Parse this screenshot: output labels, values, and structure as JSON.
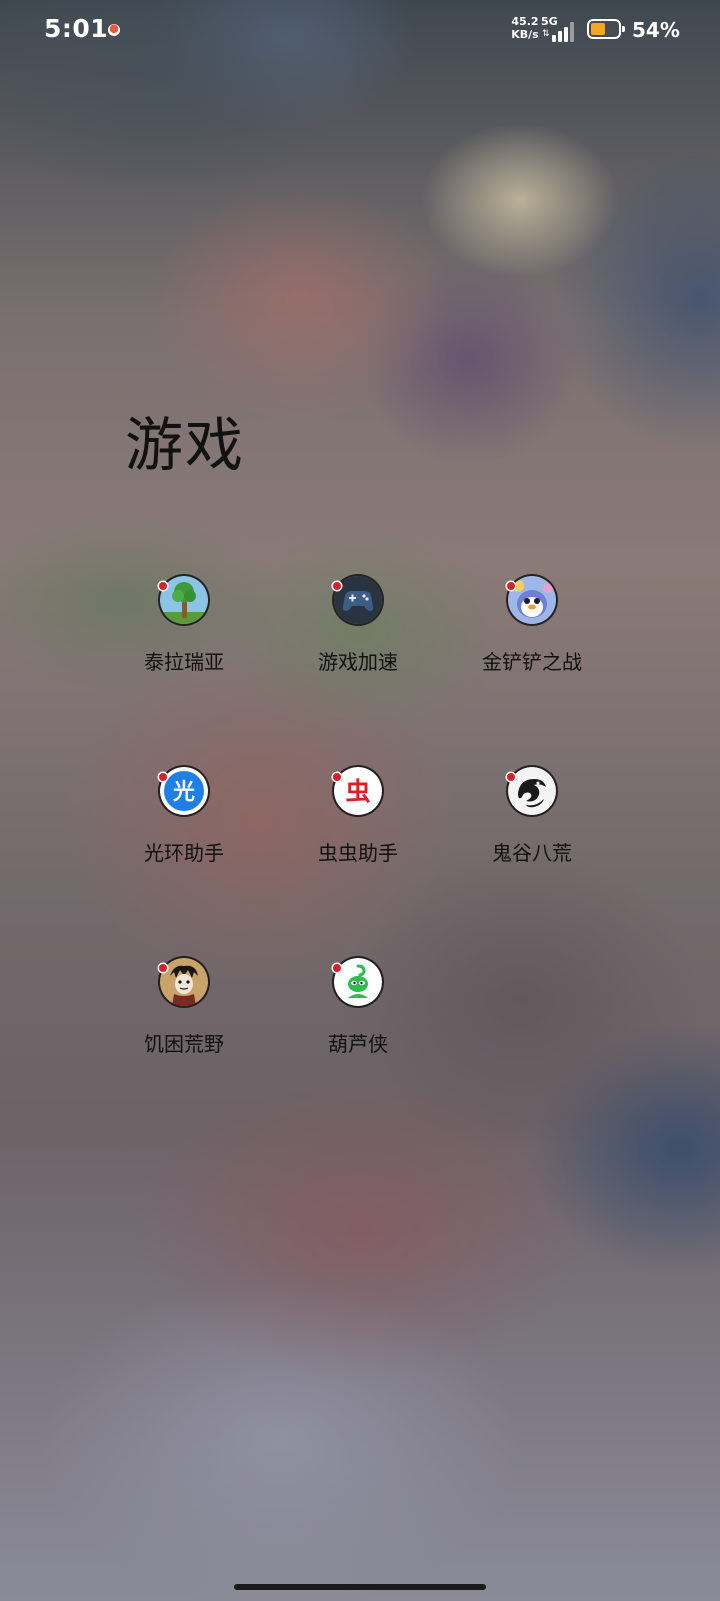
{
  "status_bar": {
    "time": "5:01",
    "net_speed_value": "45.2",
    "net_speed_unit": "KB/s",
    "network_type": "5G",
    "battery_percent": "54%",
    "battery_level": 0.54,
    "battery_color": "#f4a61d",
    "icons": [
      "notification-icon",
      "data-arrows-icon",
      "signal-icon",
      "battery-icon"
    ]
  },
  "folder": {
    "title": "游戏",
    "apps": [
      {
        "label": "泰拉瑞亚",
        "icon": "terraria-tree-icon"
      },
      {
        "label": "游戏加速",
        "icon": "gamepad-icon"
      },
      {
        "label": "金铲铲之战",
        "icon": "penguin-icon"
      },
      {
        "label": "光环助手",
        "icon": "guanghuan-icon",
        "icon_text": "光"
      },
      {
        "label": "虫虫助手",
        "icon": "chongchong-icon",
        "icon_text": "虫"
      },
      {
        "label": "鬼谷八荒",
        "icon": "dragon-icon"
      },
      {
        "label": "饥困荒野",
        "icon": "dont-starve-icon"
      },
      {
        "label": "葫芦侠",
        "icon": "huluxia-icon"
      }
    ]
  }
}
